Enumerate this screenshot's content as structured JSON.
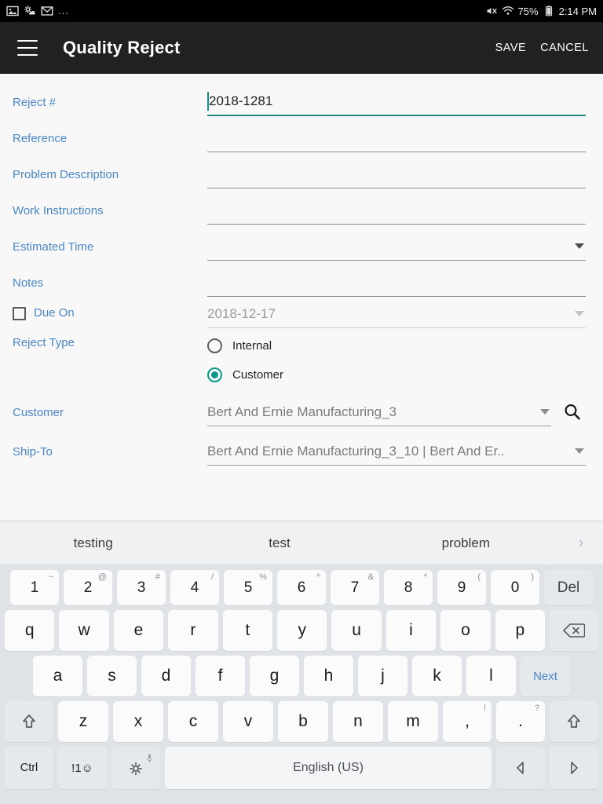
{
  "status_bar": {
    "left_icons": [
      "image-icon",
      "weather-icon",
      "mail-icon",
      "overflow-dots"
    ],
    "dots": "...",
    "right_icons": [
      "mute-icon",
      "wifi-icon",
      "battery-icon"
    ],
    "battery_percent": "75%",
    "time": "2:14 PM"
  },
  "app_bar": {
    "menu_icon": "hamburger-menu-icon",
    "title": "Quality Reject",
    "save_label": "SAVE",
    "cancel_label": "CANCEL"
  },
  "form": {
    "fields": [
      {
        "label": "Reject #",
        "value": "2018-1281",
        "type": "text",
        "focused": true
      },
      {
        "label": "Reference",
        "value": "",
        "type": "text",
        "focused": false
      },
      {
        "label": "Problem Description",
        "value": "",
        "type": "text",
        "focused": false
      },
      {
        "label": "Work Instructions",
        "value": "",
        "type": "text",
        "focused": false
      },
      {
        "label": "Estimated Time",
        "value": "",
        "type": "dropdown",
        "focused": false
      },
      {
        "label": "Notes",
        "value": "",
        "type": "text",
        "focused": false
      }
    ],
    "due_on": {
      "label": "Due On",
      "checked": false,
      "date_value": "2018-12-17"
    },
    "reject_type": {
      "label": "Reject Type",
      "options": [
        "Internal",
        "Customer"
      ],
      "selected": "Customer"
    },
    "customer": {
      "label": "Customer",
      "value": "Bert And Ernie Manufacturing_3",
      "search_icon": "search-icon"
    },
    "ship_to": {
      "label": "Ship-To",
      "value": "Bert And Ernie Manufacturing_3_10 | Bert And Er.."
    }
  },
  "keyboard": {
    "suggestions": [
      "testing",
      "test",
      "problem"
    ],
    "more_icon": "chevron-right-icon",
    "row_numbers": [
      {
        "main": "1",
        "sup": "~"
      },
      {
        "main": "2",
        "sup": "@"
      },
      {
        "main": "3",
        "sup": "#"
      },
      {
        "main": "4",
        "sup": "/"
      },
      {
        "main": "5",
        "sup": "%"
      },
      {
        "main": "6",
        "sup": "^"
      },
      {
        "main": "7",
        "sup": "&"
      },
      {
        "main": "8",
        "sup": "*"
      },
      {
        "main": "9",
        "sup": "("
      },
      {
        "main": "0",
        "sup": ")"
      }
    ],
    "del_label": "Del",
    "row_q": [
      "q",
      "w",
      "e",
      "r",
      "t",
      "y",
      "u",
      "i",
      "o",
      "p"
    ],
    "backspace_icon": "backspace-icon",
    "row_a": [
      "a",
      "s",
      "d",
      "f",
      "g",
      "h",
      "j",
      "k",
      "l"
    ],
    "next_label": "Next",
    "row_z": [
      "z",
      "x",
      "c",
      "v",
      "b",
      "n",
      "m"
    ],
    "comma_key": {
      "main": ",",
      "sup": "!"
    },
    "period_key": {
      "main": ".",
      "sup": "?"
    },
    "shift_icon": "shift-arrow-icon",
    "ctrl_label": "Ctrl",
    "symbols_label": "!1☺",
    "settings_icon": "gear-icon",
    "mic_icon": "microphone-icon",
    "space_label": "English (US)",
    "arrow_left_icon": "arrow-left-icon",
    "arrow_right_icon": "arrow-right-icon"
  },
  "colors": {
    "accent_teal": "#06998a",
    "label_blue": "#4a86c8",
    "app_bar": "#212121",
    "status_bar": "#000000",
    "keyboard_bg": "#dfe2e6"
  }
}
